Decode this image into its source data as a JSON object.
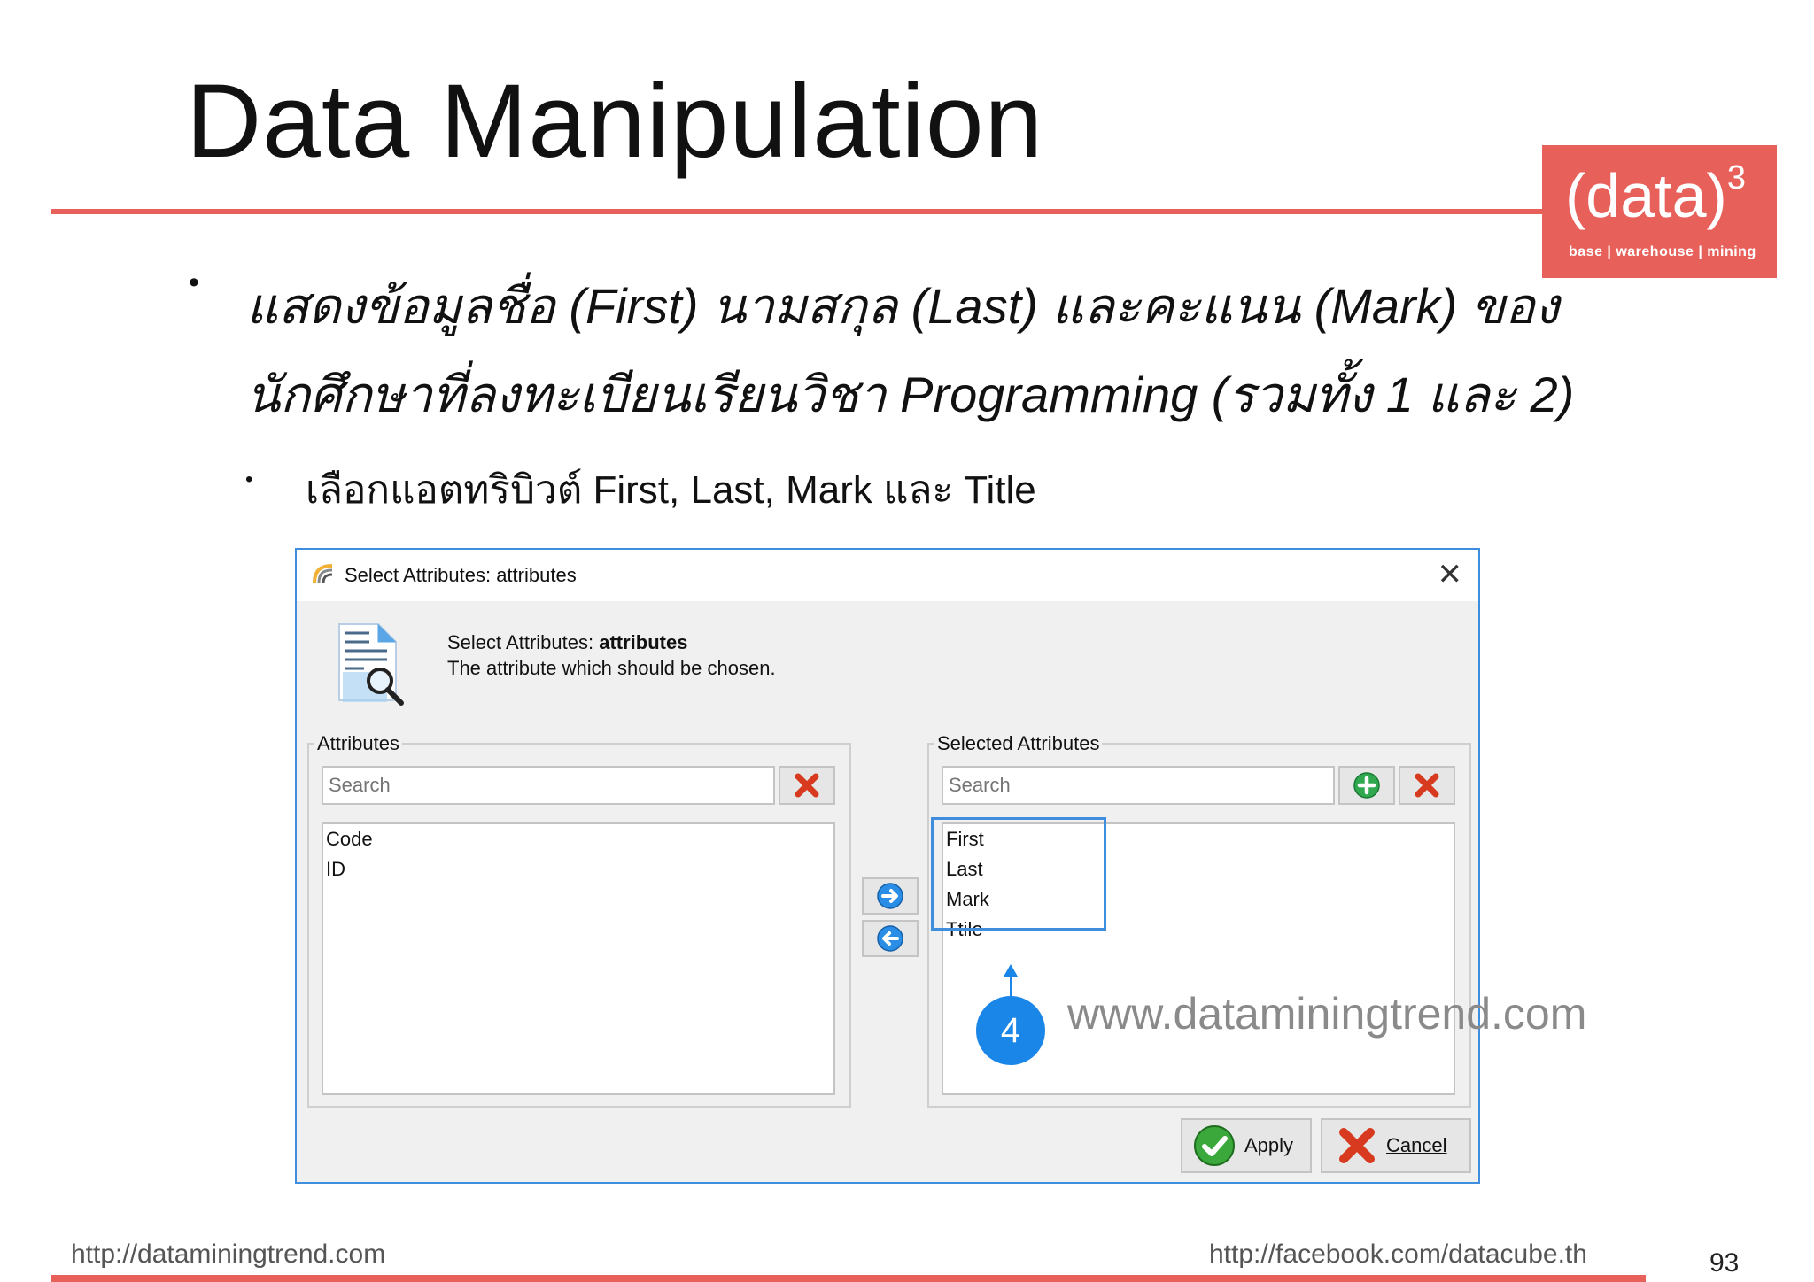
{
  "slide": {
    "title": "Data Manipulation",
    "bullet1": "แสดงข้อมูลชื่อ (First) นามสกุล (Last) และคะแนน (Mark) ของนักศึกษาที่ลงทะเบียนเรียนวิชา Programming (รวมทั้ง 1 และ 2)",
    "bullet2": "เลือกแอตทริบิวต์ First, Last, Mark และ Title",
    "bullet_glyph": "•"
  },
  "logo": {
    "main": "(data)",
    "sup": "3",
    "sub": "base | warehouse | mining",
    "color": "#e8605a"
  },
  "dialog": {
    "title": "Select Attributes: attributes",
    "close_glyph": "✕",
    "header_prefix": "Select Attributes: ",
    "header_bold": "attributes",
    "header_desc": "The attribute which should be chosen.",
    "left_group_label": "Attributes",
    "left_search_placeholder": "Search",
    "left_items": [
      "Code",
      "ID"
    ],
    "right_group_label": "Selected Attributes",
    "right_search_placeholder": "Search",
    "right_items": [
      "First",
      "Last",
      "Mark",
      "Ttile"
    ],
    "apply_label": "Apply",
    "cancel_label": "Cancel",
    "accent_color": "#3f8ede"
  },
  "callout": {
    "number": "4",
    "color": "#1a86e8"
  },
  "watermark": "www.dataminingtrend.com",
  "footer": {
    "left": "http://dataminingtrend.com",
    "right": "http://facebook.com/datacube.th",
    "page": "93"
  },
  "icons": {
    "app": "rapidminer-icon",
    "header": "document-search-icon",
    "clear": "red-x-icon",
    "add": "green-plus-icon",
    "move_right": "arrow-right-icon",
    "move_left": "arrow-left-icon",
    "apply": "check-icon",
    "cancel": "red-x-icon"
  }
}
